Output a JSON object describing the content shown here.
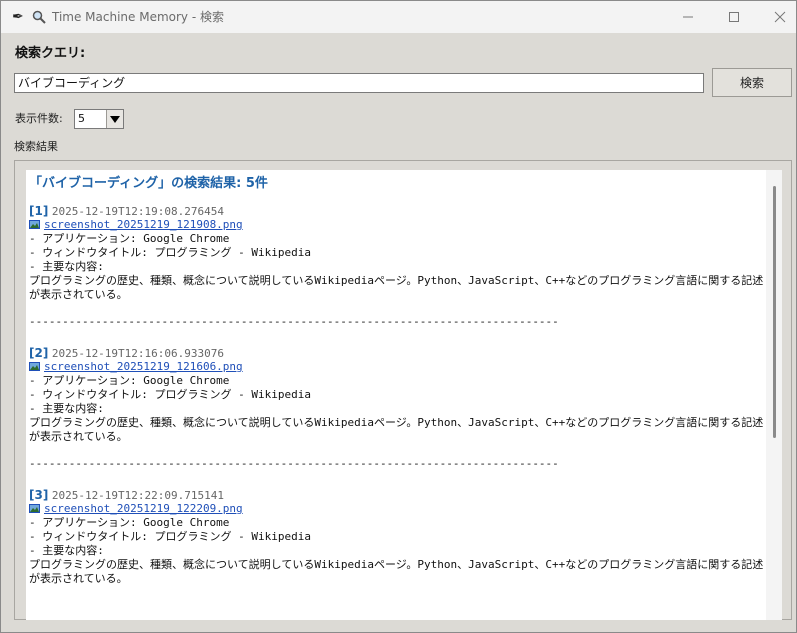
{
  "window": {
    "title": "Time Machine Memory - 検索",
    "controls": {
      "minimize_icon": "minimize-icon",
      "maximize_icon": "maximize-icon",
      "close_icon": "close-icon"
    }
  },
  "query": {
    "label": "検索クエリ:",
    "value": "バイブコーディング",
    "button_label": "検索"
  },
  "count": {
    "label": "表示件数:",
    "value": "5"
  },
  "results": {
    "label": "検索結果",
    "heading": "「バイブコーディング」の検索結果: 5件",
    "separator": "--------------------------------------------------------------------------------",
    "items": [
      {
        "number": "[1]",
        "timestamp": "2025-12-19T12:19:08.276454",
        "file": "screenshot_20251219_121908.png",
        "app": "- アプリケーション: Google Chrome",
        "window_title": "- ウィンドウタイトル: プログラミング - Wikipedia",
        "content_label": "- 主要な内容:",
        "content_line1": "プログラミングの歴史、種類、概念について説明しているWikipediaページ。Python、JavaScript、C++などのプログラミング言語に関する記述",
        "content_line2": "が表示されている。"
      },
      {
        "number": "[2]",
        "timestamp": "2025-12-19T12:16:06.933076",
        "file": "screenshot_20251219_121606.png",
        "app": "- アプリケーション: Google Chrome",
        "window_title": "- ウィンドウタイトル: プログラミング - Wikipedia",
        "content_label": "- 主要な内容:",
        "content_line1": "プログラミングの歴史、種類、概念について説明しているWikipediaページ。Python、JavaScript、C++などのプログラミング言語に関する記述",
        "content_line2": "が表示されている。"
      },
      {
        "number": "[3]",
        "timestamp": "2025-12-19T12:22:09.715141",
        "file": "screenshot_20251219_122209.png",
        "app": "- アプリケーション: Google Chrome",
        "window_title": "- ウィンドウタイトル: プログラミング - Wikipedia",
        "content_label": "- 主要な内容:",
        "content_line1": "プログラミングの歴史、種類、概念について説明しているWikipediaページ。Python、JavaScript、C++などのプログラミング言語に関する記述",
        "content_line2": "が表示されている。"
      }
    ]
  },
  "colors": {
    "accent": "#1f63a8",
    "link": "#1f4fb8",
    "background": "#dcdad5"
  }
}
